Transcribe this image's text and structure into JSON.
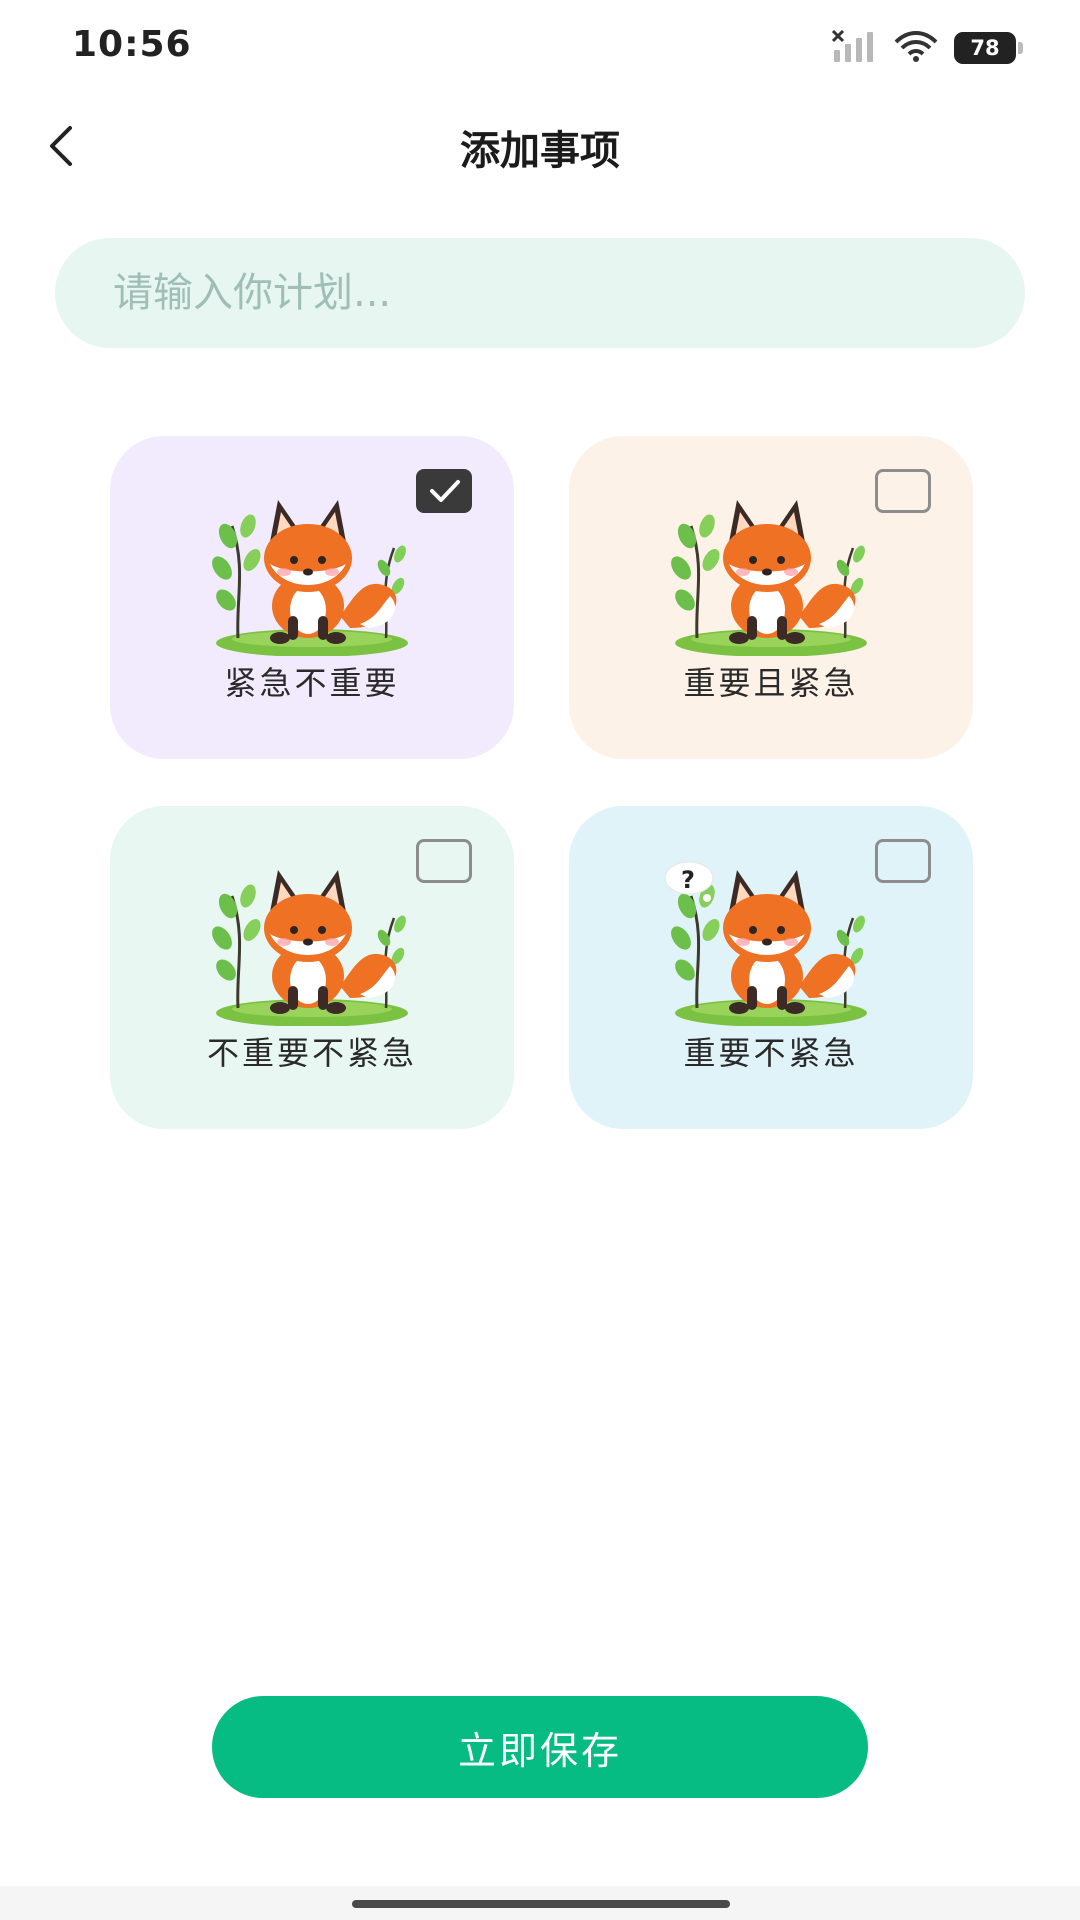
{
  "status_bar": {
    "time": "10:56",
    "battery_level": "78",
    "signal_icon": "signal-off-icon",
    "wifi_icon": "wifi-icon"
  },
  "header": {
    "title": "添加事项",
    "back_icon": "chevron-left-icon"
  },
  "plan_input": {
    "placeholder": "请输入你计划...",
    "value": ""
  },
  "categories": [
    {
      "label": "紧急不重要",
      "checked": true,
      "background": "#f1ebfd"
    },
    {
      "label": "重要且紧急",
      "checked": false,
      "background": "#fdf2e8"
    },
    {
      "label": "不重要不紧急",
      "checked": false,
      "background": "#e8f7f2"
    },
    {
      "label": "重要不紧急",
      "checked": false,
      "background": "#e0f3f9"
    }
  ],
  "save_button": {
    "label": "立即保存",
    "color": "#06bc83"
  },
  "colors": {
    "accent": "#06bc83",
    "input_background": "#e7f6f1",
    "checkbox_checked": "#3a3a3a"
  }
}
